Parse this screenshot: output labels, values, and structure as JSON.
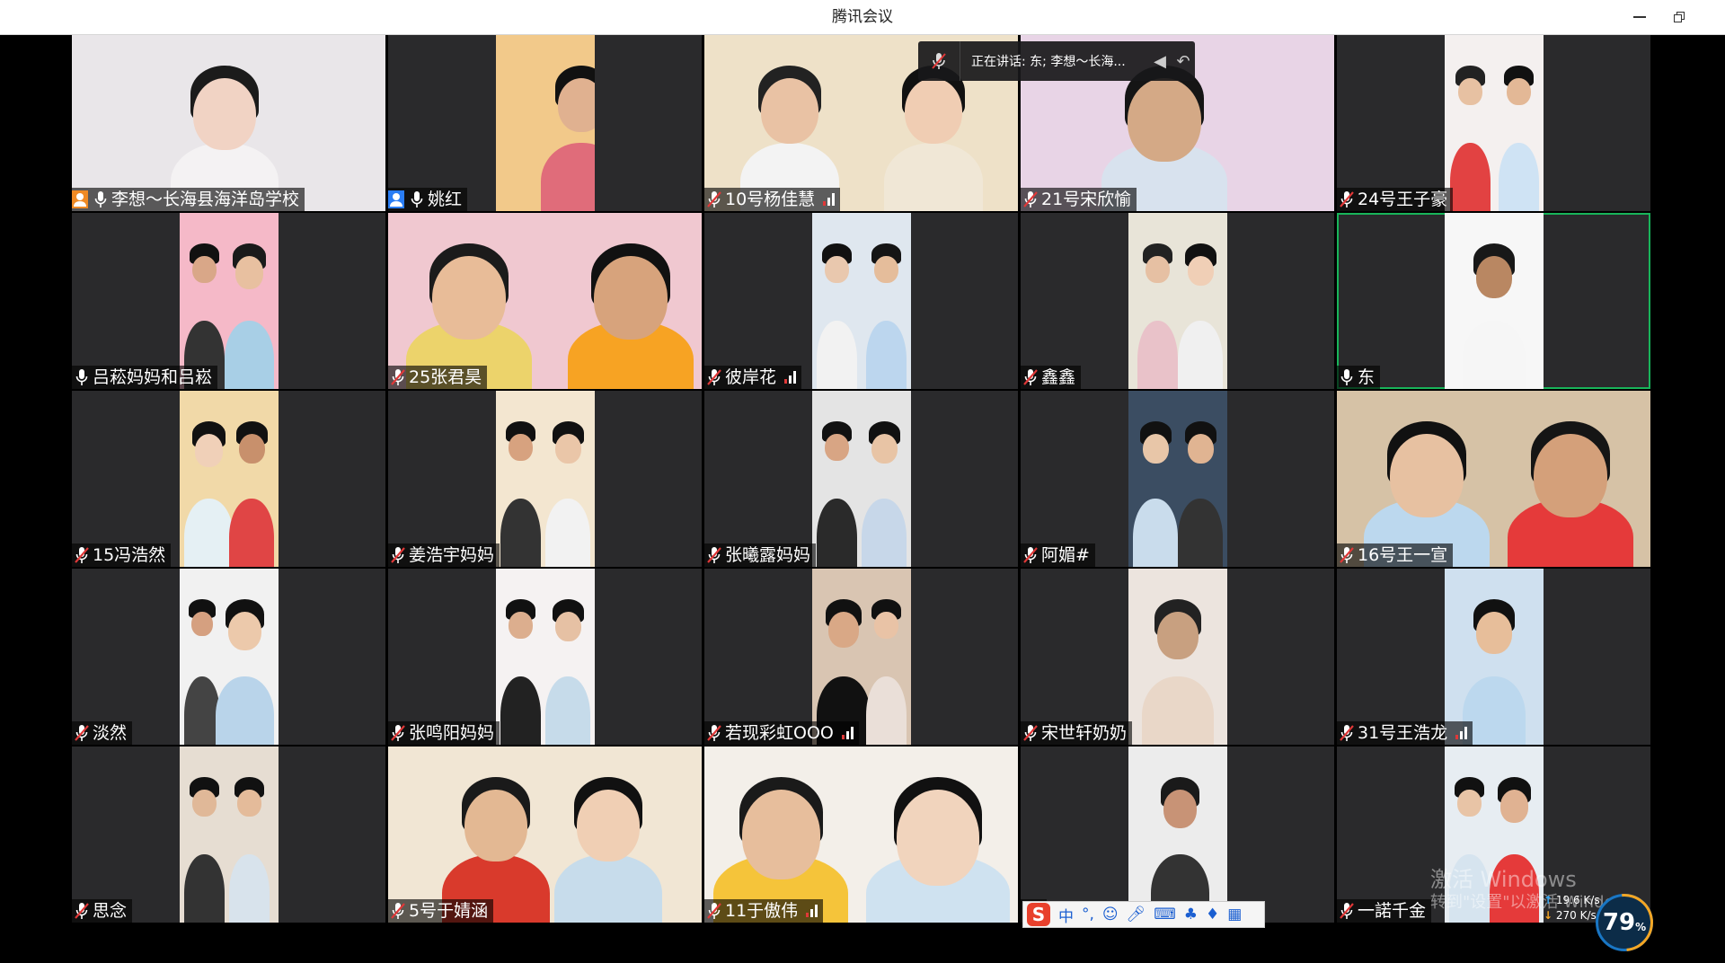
{
  "window": {
    "title": "腾讯会议"
  },
  "speaking": {
    "text": "正在讲话: 东; 李想～长海..."
  },
  "participants": [
    {
      "name": "李想～长海县海洋岛学校",
      "badge": "host",
      "mic": "on",
      "signal": false,
      "active": false
    },
    {
      "name": "姚红",
      "badge": "cohost",
      "mic": "on",
      "signal": false,
      "active": false
    },
    {
      "name": "10号杨佳慧",
      "badge": "",
      "mic": "muted",
      "signal": true,
      "active": false
    },
    {
      "name": "21号宋欣愉",
      "badge": "",
      "mic": "muted",
      "signal": false,
      "active": false
    },
    {
      "name": "24号王子豪",
      "badge": "",
      "mic": "muted",
      "signal": false,
      "active": false
    },
    {
      "name": "吕菘妈妈和吕崧",
      "badge": "",
      "mic": "on",
      "signal": false,
      "active": false
    },
    {
      "name": "25张君昊",
      "badge": "",
      "mic": "muted",
      "signal": false,
      "active": false
    },
    {
      "name": "彼岸花",
      "badge": "",
      "mic": "muted",
      "signal": true,
      "active": false
    },
    {
      "name": "鑫鑫",
      "badge": "",
      "mic": "muted",
      "signal": false,
      "active": false
    },
    {
      "name": "东",
      "badge": "",
      "mic": "on",
      "signal": false,
      "active": true
    },
    {
      "name": "15冯浩然",
      "badge": "",
      "mic": "muted",
      "signal": false,
      "active": false
    },
    {
      "name": "姜浩宇妈妈",
      "badge": "",
      "mic": "muted",
      "signal": false,
      "active": false
    },
    {
      "name": "张曦露妈妈",
      "badge": "",
      "mic": "muted",
      "signal": false,
      "active": false
    },
    {
      "name": "阿媚#",
      "badge": "",
      "mic": "muted",
      "signal": false,
      "active": false
    },
    {
      "name": "16号王一宣",
      "badge": "",
      "mic": "muted",
      "signal": false,
      "active": false
    },
    {
      "name": "淡然",
      "badge": "",
      "mic": "muted",
      "signal": false,
      "active": false
    },
    {
      "name": "张鸣阳妈妈",
      "badge": "",
      "mic": "muted",
      "signal": false,
      "active": false
    },
    {
      "name": "若现彩虹OOO",
      "badge": "",
      "mic": "muted",
      "signal": true,
      "active": false
    },
    {
      "name": "宋世轩奶奶",
      "badge": "",
      "mic": "muted",
      "signal": false,
      "active": false
    },
    {
      "name": "31号王浩龙",
      "badge": "",
      "mic": "muted",
      "signal": true,
      "active": false
    },
    {
      "name": "思念",
      "badge": "",
      "mic": "muted",
      "signal": false,
      "active": false
    },
    {
      "name": "5号于婧涵",
      "badge": "",
      "mic": "muted",
      "signal": false,
      "active": false
    },
    {
      "name": "11于傲伟",
      "badge": "",
      "mic": "muted",
      "signal": true,
      "active": false
    },
    {
      "name": "",
      "badge": "",
      "mic": "muted",
      "signal": false,
      "active": false
    },
    {
      "name": "一諾千金",
      "badge": "",
      "mic": "muted",
      "signal": false,
      "active": false
    }
  ],
  "ime": {
    "logo": "S",
    "mode": "中",
    "punct": "°,",
    "items": [
      "emoji-icon",
      "voice-icon",
      "keyboard-icon",
      "skin-icon",
      "shirt-icon",
      "toolbox-icon"
    ]
  },
  "watermark": {
    "line1": "激活 Windows",
    "line2": "转到\"设置\"以激活 Windows。"
  },
  "network": {
    "up": "19.6 K/s",
    "down": "270 K/s",
    "percent": "79",
    "percent_unit": "%"
  },
  "colors": {
    "host_badge": "#f08a24",
    "cohost_badge": "#2a7df4",
    "active_border": "#18b45a"
  }
}
